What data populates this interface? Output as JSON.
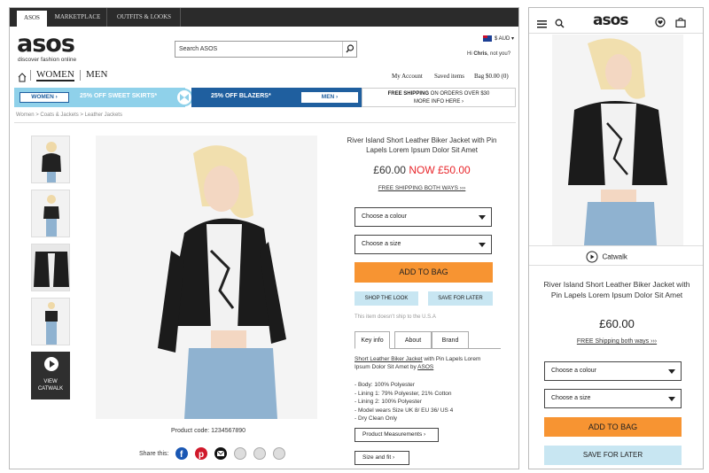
{
  "desktop": {
    "top_nav": {
      "tabs": [
        {
          "label": "ASOS"
        },
        {
          "label": "MARKETPLACE"
        },
        {
          "label": "OUTFITS & LOOKS"
        }
      ]
    },
    "logo": {
      "text": "asos",
      "tagline": "discover fashion online"
    },
    "search": {
      "placeholder": "Search ASOS"
    },
    "currency": {
      "label": "$ AUD ▾"
    },
    "greeting": {
      "hi": "Hi",
      "name": "Chris",
      "not_you": ", not you?"
    },
    "gender_nav": {
      "women": "WOMEN",
      "men": "MEN"
    },
    "account_links": {
      "my_account": "My Account",
      "saved_items": "Saved items",
      "bag": "Bag",
      "bag_total": "$0.00",
      "bag_count": "(0)"
    },
    "banner": {
      "women_btn": "WOMEN ›",
      "promo1": "25% OFF SWEET SKIRTS*",
      "promo2": "25% OFF BLAZERS*",
      "men_btn": "MEN ›",
      "shipping_bold": "FREE SHIPPING",
      "shipping_rest": " ON ORDERS OVER $30",
      "more_info": "MORE INFO HERE ›"
    },
    "breadcrumb": "Women > Coats & Jackets > Leather Jackets",
    "thumb_catwalk": {
      "line1": "VIEW",
      "line2": "CATWALK"
    },
    "product_code": "Product code: 1234567890",
    "share_label": "Share this:",
    "product": {
      "title": "River Island Short Leather Biker Jacket with Pin Lapels Lorem Ipsum Dolor Sit Amet",
      "old_price": "£60.00",
      "now_price": "NOW £50.00",
      "free_shipping": "FREE SHIPPING BOTH WAYS ›››",
      "colour_select": "Choose a colour",
      "size_select": "Choose a size",
      "add_to_bag": "ADD TO BAG",
      "shop_the_look": "SHOP THE LOOK",
      "save_for_later": "SAVE FOR LATER",
      "no_ship_note": "This item doesn't ship to the U.S.A",
      "tabs": [
        {
          "label": "Key info"
        },
        {
          "label": "About"
        },
        {
          "label": "Brand"
        }
      ],
      "desc_link": "Short Leather Biker Jacket",
      "desc_mid": " with Pin Lapels Lorem Ipsum Dolor Sit Amet by ",
      "desc_brand": "ASOS",
      "details": [
        "- Body: 100% Polyester",
        "- Lining 1: 79% Polyester, 21% Cotton",
        "- Lining 2: 100% Polyester",
        "- Model wears Size UK 8/ EU 36/ US 4",
        "- Dry Clean Only"
      ],
      "measurements_btn": "Product Measurements ›",
      "size_fit_btn": "Size and fit ›"
    }
  },
  "mobile": {
    "logo": "asos",
    "catwalk": "Catwalk",
    "title": "River Island Short Leather Biker Jacket with Pin Lapels Lorem Ipsum Dolor Sit Amet",
    "price": "£60.00",
    "free_shipping": "FREE Shipping both ways ›››",
    "colour_select": "Choose a colour",
    "size_select": "Choose a size",
    "add_to_bag": "ADD TO BAG",
    "save_for_later": "SAVE FOR LATER"
  },
  "colors": {
    "orange": "#f79432",
    "light_blue": "#c8e6f2",
    "banner_blue": "#1f5f9f",
    "sale_red": "#e8262b",
    "dark_bar": "#2b2b2b"
  }
}
